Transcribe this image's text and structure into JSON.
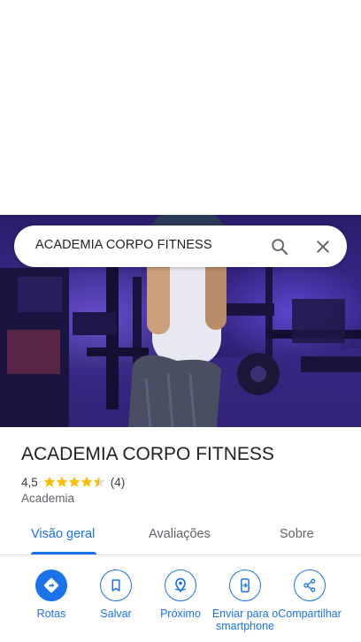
{
  "search": {
    "query": "ACADEMIA CORPO FITNESS"
  },
  "place": {
    "name": "ACADEMIA CORPO FITNESS",
    "rating": "4,5",
    "rating_value": 4.5,
    "review_count": "(4)",
    "category": "Academia"
  },
  "tabs": [
    {
      "label": "Visão geral",
      "active": true
    },
    {
      "label": "Avaliações",
      "active": false
    },
    {
      "label": "Sobre",
      "active": false
    }
  ],
  "actions": [
    {
      "label": "Rotas",
      "icon": "directions-icon"
    },
    {
      "label": "Salvar",
      "icon": "bookmark-icon"
    },
    {
      "label": "Próximo",
      "icon": "nearby-icon"
    },
    {
      "label": "Enviar para o smartphone",
      "icon": "send-to-phone-icon"
    },
    {
      "label": "Compartilhar",
      "icon": "share-icon"
    }
  ],
  "colors": {
    "accent": "#1a73e8",
    "star": "#fbbc04",
    "text": "#202124",
    "secondary_text": "#5f6368"
  }
}
